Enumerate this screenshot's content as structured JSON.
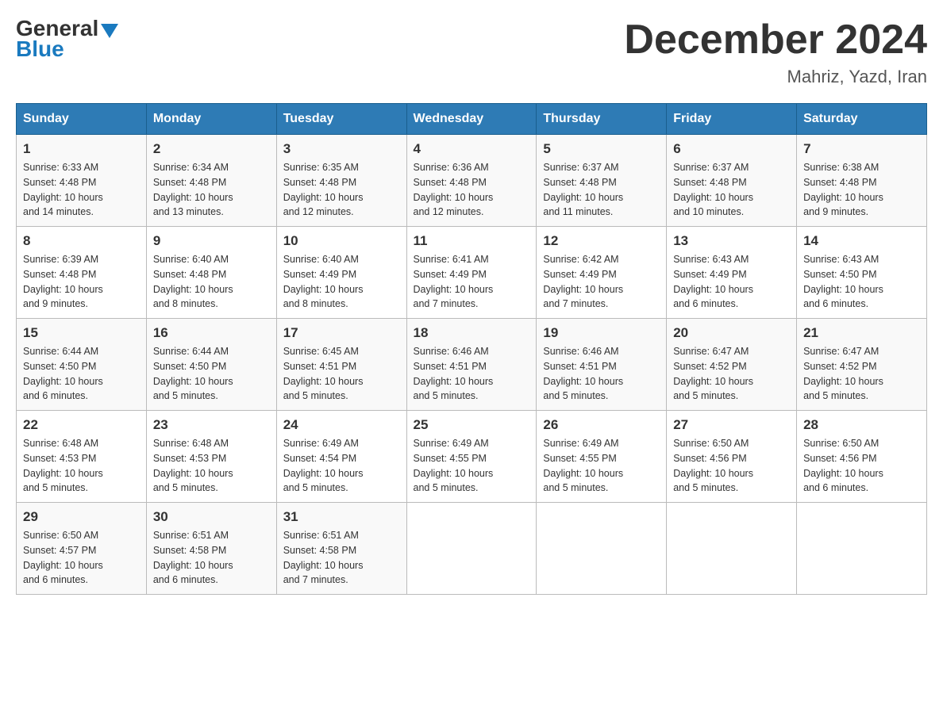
{
  "header": {
    "logo_general": "General",
    "logo_blue": "Blue",
    "month_title": "December 2024",
    "location": "Mahriz, Yazd, Iran"
  },
  "weekdays": [
    "Sunday",
    "Monday",
    "Tuesday",
    "Wednesday",
    "Thursday",
    "Friday",
    "Saturday"
  ],
  "weeks": [
    [
      {
        "day": "1",
        "sunrise": "6:33 AM",
        "sunset": "4:48 PM",
        "daylight": "10 hours and 14 minutes."
      },
      {
        "day": "2",
        "sunrise": "6:34 AM",
        "sunset": "4:48 PM",
        "daylight": "10 hours and 13 minutes."
      },
      {
        "day": "3",
        "sunrise": "6:35 AM",
        "sunset": "4:48 PM",
        "daylight": "10 hours and 12 minutes."
      },
      {
        "day": "4",
        "sunrise": "6:36 AM",
        "sunset": "4:48 PM",
        "daylight": "10 hours and 12 minutes."
      },
      {
        "day": "5",
        "sunrise": "6:37 AM",
        "sunset": "4:48 PM",
        "daylight": "10 hours and 11 minutes."
      },
      {
        "day": "6",
        "sunrise": "6:37 AM",
        "sunset": "4:48 PM",
        "daylight": "10 hours and 10 minutes."
      },
      {
        "day": "7",
        "sunrise": "6:38 AM",
        "sunset": "4:48 PM",
        "daylight": "10 hours and 9 minutes."
      }
    ],
    [
      {
        "day": "8",
        "sunrise": "6:39 AM",
        "sunset": "4:48 PM",
        "daylight": "10 hours and 9 minutes."
      },
      {
        "day": "9",
        "sunrise": "6:40 AM",
        "sunset": "4:48 PM",
        "daylight": "10 hours and 8 minutes."
      },
      {
        "day": "10",
        "sunrise": "6:40 AM",
        "sunset": "4:49 PM",
        "daylight": "10 hours and 8 minutes."
      },
      {
        "day": "11",
        "sunrise": "6:41 AM",
        "sunset": "4:49 PM",
        "daylight": "10 hours and 7 minutes."
      },
      {
        "day": "12",
        "sunrise": "6:42 AM",
        "sunset": "4:49 PM",
        "daylight": "10 hours and 7 minutes."
      },
      {
        "day": "13",
        "sunrise": "6:43 AM",
        "sunset": "4:49 PM",
        "daylight": "10 hours and 6 minutes."
      },
      {
        "day": "14",
        "sunrise": "6:43 AM",
        "sunset": "4:50 PM",
        "daylight": "10 hours and 6 minutes."
      }
    ],
    [
      {
        "day": "15",
        "sunrise": "6:44 AM",
        "sunset": "4:50 PM",
        "daylight": "10 hours and 6 minutes."
      },
      {
        "day": "16",
        "sunrise": "6:44 AM",
        "sunset": "4:50 PM",
        "daylight": "10 hours and 5 minutes."
      },
      {
        "day": "17",
        "sunrise": "6:45 AM",
        "sunset": "4:51 PM",
        "daylight": "10 hours and 5 minutes."
      },
      {
        "day": "18",
        "sunrise": "6:46 AM",
        "sunset": "4:51 PM",
        "daylight": "10 hours and 5 minutes."
      },
      {
        "day": "19",
        "sunrise": "6:46 AM",
        "sunset": "4:51 PM",
        "daylight": "10 hours and 5 minutes."
      },
      {
        "day": "20",
        "sunrise": "6:47 AM",
        "sunset": "4:52 PM",
        "daylight": "10 hours and 5 minutes."
      },
      {
        "day": "21",
        "sunrise": "6:47 AM",
        "sunset": "4:52 PM",
        "daylight": "10 hours and 5 minutes."
      }
    ],
    [
      {
        "day": "22",
        "sunrise": "6:48 AM",
        "sunset": "4:53 PM",
        "daylight": "10 hours and 5 minutes."
      },
      {
        "day": "23",
        "sunrise": "6:48 AM",
        "sunset": "4:53 PM",
        "daylight": "10 hours and 5 minutes."
      },
      {
        "day": "24",
        "sunrise": "6:49 AM",
        "sunset": "4:54 PM",
        "daylight": "10 hours and 5 minutes."
      },
      {
        "day": "25",
        "sunrise": "6:49 AM",
        "sunset": "4:55 PM",
        "daylight": "10 hours and 5 minutes."
      },
      {
        "day": "26",
        "sunrise": "6:49 AM",
        "sunset": "4:55 PM",
        "daylight": "10 hours and 5 minutes."
      },
      {
        "day": "27",
        "sunrise": "6:50 AM",
        "sunset": "4:56 PM",
        "daylight": "10 hours and 5 minutes."
      },
      {
        "day": "28",
        "sunrise": "6:50 AM",
        "sunset": "4:56 PM",
        "daylight": "10 hours and 6 minutes."
      }
    ],
    [
      {
        "day": "29",
        "sunrise": "6:50 AM",
        "sunset": "4:57 PM",
        "daylight": "10 hours and 6 minutes."
      },
      {
        "day": "30",
        "sunrise": "6:51 AM",
        "sunset": "4:58 PM",
        "daylight": "10 hours and 6 minutes."
      },
      {
        "day": "31",
        "sunrise": "6:51 AM",
        "sunset": "4:58 PM",
        "daylight": "10 hours and 7 minutes."
      },
      null,
      null,
      null,
      null
    ]
  ],
  "labels": {
    "sunrise": "Sunrise:",
    "sunset": "Sunset:",
    "daylight": "Daylight:"
  }
}
